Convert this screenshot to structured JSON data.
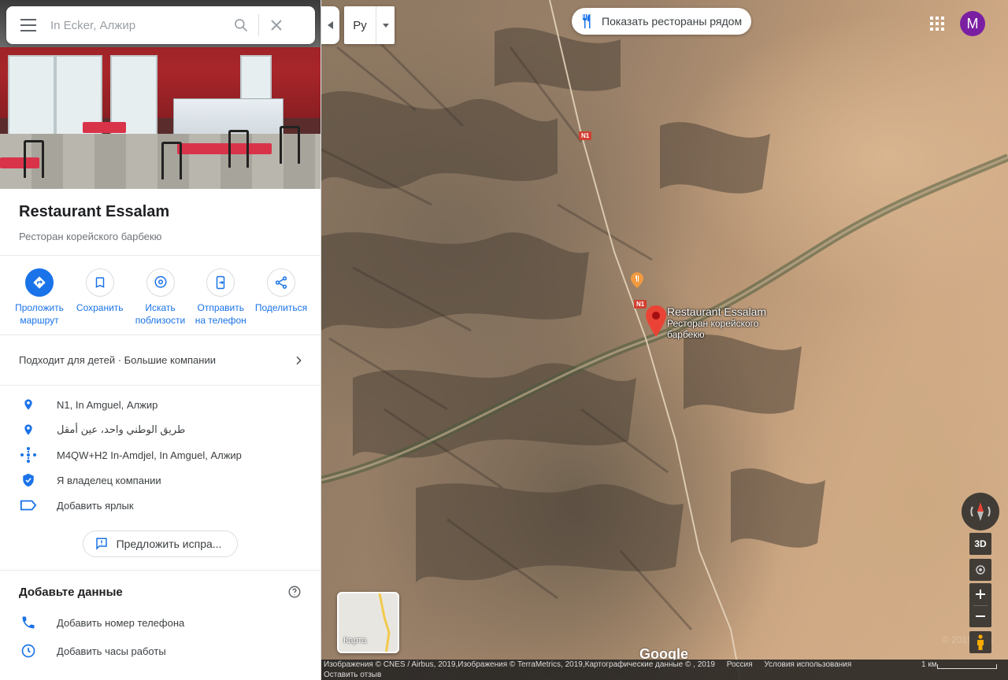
{
  "search": {
    "placeholder": "In Ecker, Алжир"
  },
  "lang": {
    "code": "Ру"
  },
  "nearby": {
    "label": "Показать рестораны рядом"
  },
  "account": {
    "initial": "M",
    "color": "#7b1fa2"
  },
  "place": {
    "name": "Restaurant Essalam",
    "category": "Ресторан корейского барбекю"
  },
  "actions": [
    {
      "label": "Проложить маршрут",
      "icon": "directions-icon"
    },
    {
      "label": "Сохранить",
      "icon": "bookmark-icon"
    },
    {
      "label": "Искать поблизости",
      "icon": "nearby-icon"
    },
    {
      "label": "Отправить на телефон",
      "icon": "send-to-phone-icon"
    },
    {
      "label": "Поделиться",
      "icon": "share-icon"
    }
  ],
  "attributes": "Подходит для детей · Большие компании",
  "info": {
    "address": "N1, In Amguel, Алжир",
    "address_ar": "طريق الوطني واحد، عين أمقل",
    "plus_code": "M4QW+H2 In-Amdjel, In Amguel, Алжир",
    "owner": "Я владелец компании",
    "label": "Добавить ярлык"
  },
  "suggest": "Предложить испра...",
  "add_data": {
    "title": "Добавьте данные",
    "phone": "Добавить номер телефона",
    "hours": "Добавить часы работы"
  },
  "map": {
    "marker_name": "Restaurant Essalam",
    "marker_sub": "Ресторан корейского барбекю",
    "route": "N1",
    "btn_3d": "3D",
    "thumb_label": "Карта",
    "google": "Google",
    "copyright_faded": "© 2019 Goo"
  },
  "footer": {
    "attribution": "Изображения © CNES / Airbus, 2019,Изображения © TerraMetrics, 2019,Картографические данные © , 2019",
    "region": "Россия",
    "terms": "Условия использования",
    "feedback": "Оставить отзыв",
    "scale": "1 км"
  },
  "colors": {
    "accent": "#1a73e8",
    "pin": "#ea4335"
  }
}
